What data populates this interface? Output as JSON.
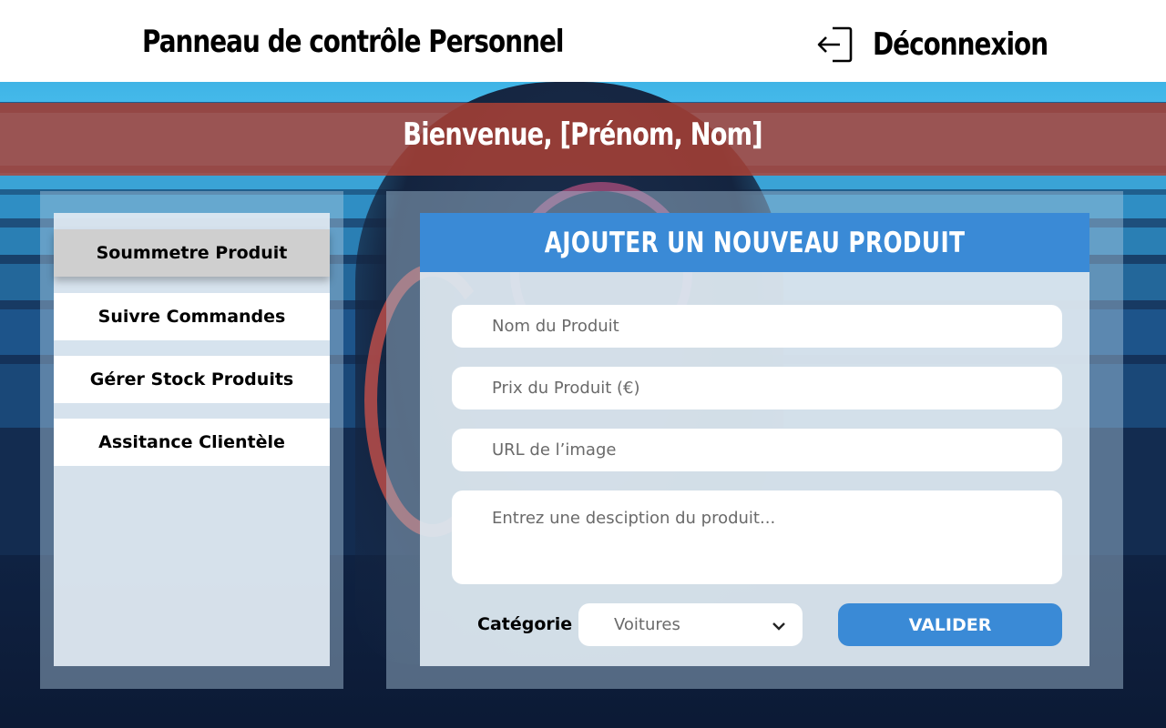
{
  "header": {
    "title": "Panneau de contrôle Personnel",
    "logout_label": "Déconnexion",
    "logout_icon": "logout-icon"
  },
  "welcome": "Bienvenue, [Prénom, Nom]",
  "sidebar": {
    "items": [
      {
        "label": "Soummetre Produit",
        "active": true
      },
      {
        "label": "Suivre Commandes",
        "active": false
      },
      {
        "label": "Gérer Stock Produits",
        "active": false
      },
      {
        "label": "Assitance Clientèle",
        "active": false
      }
    ]
  },
  "form": {
    "title": "AJOUTER UN NOUVEAU PRODUIT",
    "name_placeholder": "Nom du Produit",
    "price_placeholder": "Prix du Produit (€)",
    "image_placeholder": "URL de l’image",
    "description_placeholder": "Entrez une desciption du produit...",
    "category_label": "Catégorie",
    "category_value": "Voitures",
    "submit_label": "VALIDER"
  },
  "colors": {
    "accent": "#3a8ad6",
    "banner": "#b04234",
    "active_nav": "#cfcfcf"
  }
}
